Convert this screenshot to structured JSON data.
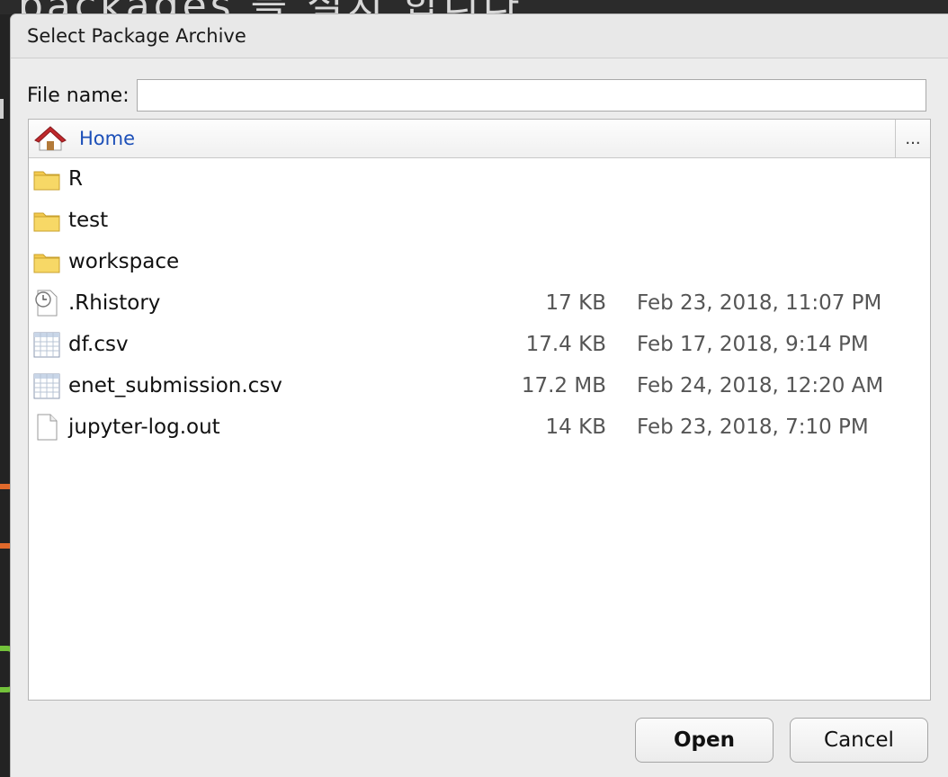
{
  "dialog": {
    "title": "Select Package Archive",
    "filename_label": "File name:",
    "filename_value": "",
    "path": {
      "home_label": "Home",
      "more_label": "..."
    },
    "files": [
      {
        "name": "R",
        "size": "",
        "date": "",
        "icon": "folder-icon"
      },
      {
        "name": "test",
        "size": "",
        "date": "",
        "icon": "folder-icon"
      },
      {
        "name": "workspace",
        "size": "",
        "date": "",
        "icon": "folder-icon"
      },
      {
        "name": ".Rhistory",
        "size": "17 KB",
        "date": "Feb 23, 2018, 11:07 PM",
        "icon": "history-file-icon"
      },
      {
        "name": "df.csv",
        "size": "17.4 KB",
        "date": "Feb 17, 2018, 9:14 PM",
        "icon": "csv-file-icon"
      },
      {
        "name": "enet_submission.csv",
        "size": "17.2 MB",
        "date": "Feb 24, 2018, 12:20 AM",
        "icon": "csv-file-icon"
      },
      {
        "name": "jupyter-log.out",
        "size": "14 KB",
        "date": "Feb 23, 2018, 7:10 PM",
        "icon": "text-file-icon"
      }
    ],
    "buttons": {
      "open": "Open",
      "cancel": "Cancel"
    }
  },
  "colors": {
    "link": "#1c4fb8",
    "folder": "#f3c94d",
    "home_roof": "#c0282c"
  }
}
